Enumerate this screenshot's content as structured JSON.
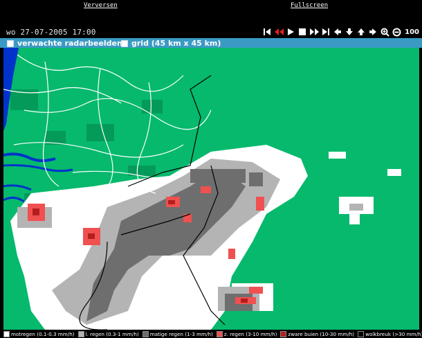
{
  "links": {
    "refresh": "Verversen",
    "fullscreen": "Fullscreen"
  },
  "timestamp": "wo 27-07-2005 17:00",
  "controls": [
    {
      "name": "first-frame-icon"
    },
    {
      "name": "rewind-icon"
    },
    {
      "name": "play-icon"
    },
    {
      "name": "stop-icon"
    },
    {
      "name": "fast-forward-icon"
    },
    {
      "name": "last-frame-icon"
    },
    {
      "name": "pan-left-icon"
    },
    {
      "name": "pan-down-icon"
    },
    {
      "name": "pan-up-icon"
    },
    {
      "name": "pan-right-icon"
    },
    {
      "name": "zoom-in-icon"
    },
    {
      "name": "zoom-out-icon"
    }
  ],
  "zoom": "100",
  "options": {
    "radar": "verwachte radarbeelden",
    "grid": "grid (45 km x 45 km)"
  },
  "legend": [
    {
      "label": "motregen (0.1-0.3 mm/h)",
      "color": "#ffffff"
    },
    {
      "label": "l. regen (0.3-1 mm/h)",
      "color": "#b4b4b4"
    },
    {
      "label": "matige regen (1-3 mm/h)",
      "color": "#6e6e6e"
    },
    {
      "label": "z. regen (3-10 mm/h)",
      "color": "#f05050"
    },
    {
      "label": "zware buien (10-30 mm/h)",
      "color": "#b41e1e"
    },
    {
      "label": "wolkbreuk (>30 mm/h)",
      "color": "#000000"
    }
  ],
  "colors": {
    "land": "#06b96d",
    "sea": "#0033cc",
    "outside": "#ffffff",
    "option_bar": "#3b9ac3"
  }
}
